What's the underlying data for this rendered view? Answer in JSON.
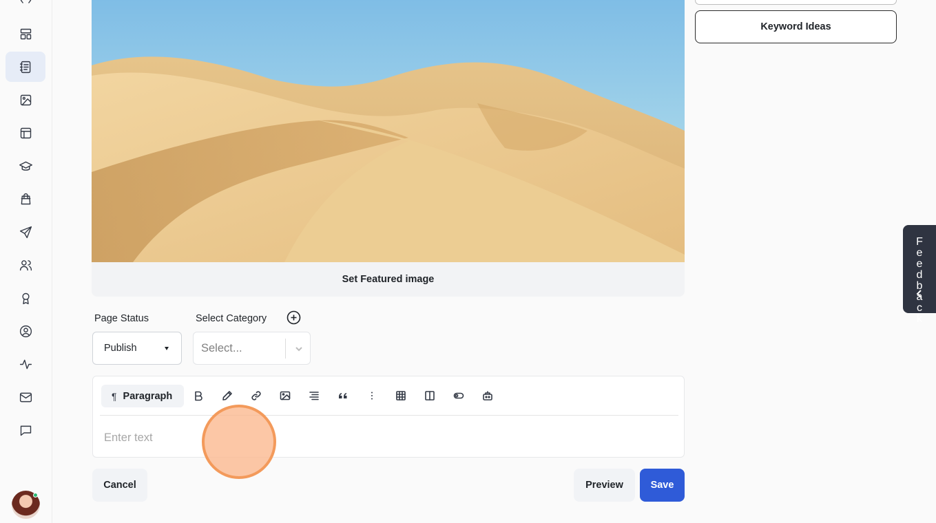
{
  "rail": {
    "items": [
      {
        "icon": "blog-icon"
      },
      {
        "icon": "layout-grid-icon"
      },
      {
        "icon": "notebook-icon",
        "active": true
      },
      {
        "icon": "image-icon"
      },
      {
        "icon": "template-icon"
      },
      {
        "icon": "graduation-cap-icon"
      },
      {
        "icon": "shopping-bag-icon"
      },
      {
        "icon": "send-icon"
      },
      {
        "icon": "users-icon"
      },
      {
        "icon": "award-icon"
      },
      {
        "icon": "user-circle-icon"
      },
      {
        "icon": "activity-icon"
      },
      {
        "icon": "mail-icon"
      },
      {
        "icon": "message-icon"
      }
    ]
  },
  "featured": {
    "set_label": "Set Featured image"
  },
  "right_panel": {
    "keyword_button": "Keyword Ideas"
  },
  "feedback": {
    "letters": [
      "F",
      "e",
      "e",
      "d",
      "b",
      "a",
      "c",
      "k"
    ]
  },
  "fields": {
    "page_status_label": "Page Status",
    "page_status_value": "Publish",
    "category_label": "Select Category",
    "category_placeholder": "Select..."
  },
  "editor": {
    "block_type": "Paragraph",
    "block_icon": "¶",
    "placeholder": "Enter text",
    "tools": [
      "bold-icon",
      "pen-icon",
      "link-icon",
      "image-icon",
      "align-icon",
      "quote-icon",
      "more-vertical-icon",
      "table-icon",
      "columns-icon",
      "toggle-icon",
      "embed-icon"
    ]
  },
  "footer": {
    "cancel": "Cancel",
    "preview": "Preview",
    "save": "Save"
  },
  "colors": {
    "primary": "#2f5bd8",
    "feedback_bg": "#2f3441",
    "cursor_ring": "#f39a5b"
  }
}
